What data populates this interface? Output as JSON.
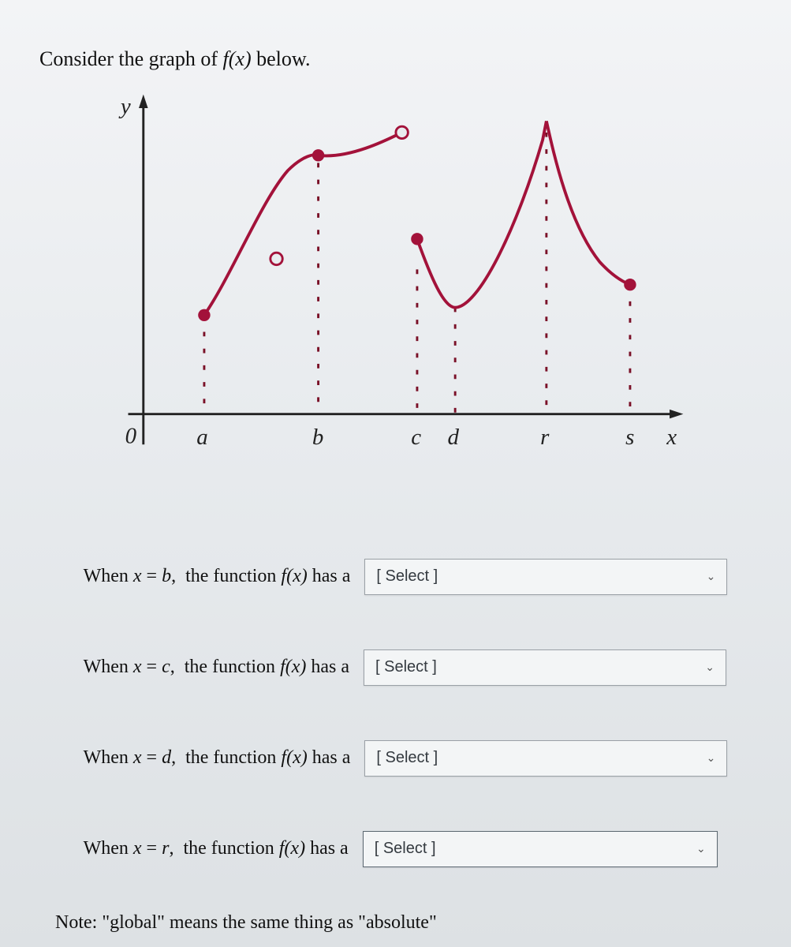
{
  "prompt": {
    "pre": "Consider the graph of ",
    "fn": "f(x)",
    "post": " below."
  },
  "axes": {
    "y_label": "y",
    "x_label": "x",
    "origin_label": "0"
  },
  "ticks": [
    "a",
    "b",
    "c",
    "d",
    "r",
    "s"
  ],
  "questions": [
    {
      "var": "b",
      "select": "[ Select ]"
    },
    {
      "var": "c",
      "select": "[ Select ]"
    },
    {
      "var": "d",
      "select": "[ Select ]"
    },
    {
      "var": "r",
      "select": "[ Select ]"
    }
  ],
  "q_text": {
    "pre": "When ",
    "xeq": "x",
    "eq": " = ",
    "mid": ",  the function ",
    "fn": "f(x)",
    "post": " has a"
  },
  "note": "Note: \"global\" means the same thing as \"absolute\"",
  "chart_data": {
    "type": "line",
    "xlabel": "x",
    "ylabel": "y",
    "x_ticks": [
      "a",
      "b",
      "c",
      "d",
      "r",
      "s"
    ],
    "pieces": [
      {
        "desc": "segment 1: rises from closed point at x=a to closed local max at x=b, then continues to open (hollow) point above x=c",
        "endpoints": {
          "start": {
            "x": "a",
            "type": "closed"
          },
          "local_max": {
            "x": "b",
            "type": "closed"
          },
          "end": {
            "x": "c",
            "type": "open_high"
          }
        }
      },
      {
        "desc": "isolated open point on curve 1 between a and b (hole) below the curve",
        "point": {
          "x": "between a and b",
          "type": "open"
        }
      },
      {
        "desc": "segment 2: starts at closed point at x=c (lower than segment1 end), dips to minimum near x=d, rises steeply to a cusp/peak at x=r (global max), then decreases to closed endpoint at x=s",
        "endpoints": {
          "start": {
            "x": "c",
            "type": "closed"
          },
          "min": {
            "x": "d"
          },
          "cusp_peak": {
            "x": "r"
          },
          "end": {
            "x": "s",
            "type": "closed"
          }
        }
      }
    ],
    "notes": "y-axis values are not labeled; only relative heights are meaningful"
  }
}
